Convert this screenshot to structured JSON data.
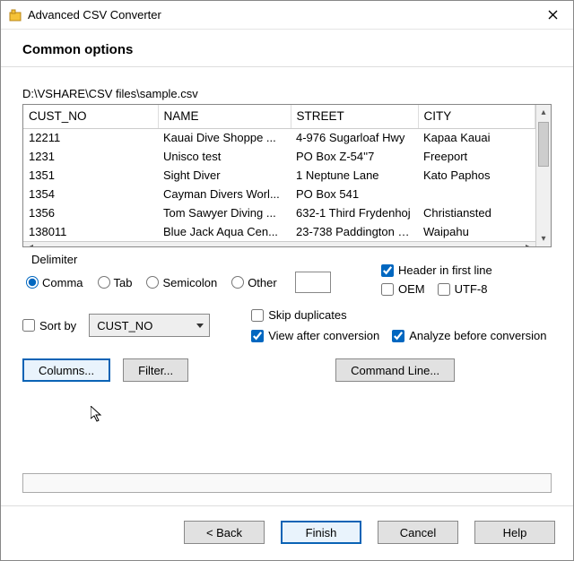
{
  "window": {
    "title": "Advanced CSV Converter"
  },
  "heading": "Common options",
  "filepath": "D:\\VSHARE\\CSV files\\sample.csv",
  "table": {
    "columns": [
      "CUST_NO",
      "NAME",
      "STREET",
      "CITY"
    ],
    "rows": [
      [
        "12211",
        " Kauai Dive Shoppe ...",
        "4-976 Sugarloaf Hwy",
        "Kapaa Kauai"
      ],
      [
        "1231",
        "Unisco  test",
        "PO Box Z-54''7",
        "Freeport"
      ],
      [
        "1351",
        "Sight Diver",
        "1 Neptune Lane",
        "Kato Paphos"
      ],
      [
        "1354",
        "Cayman Divers Worl...",
        "PO Box 541",
        ""
      ],
      [
        "1356",
        "Tom Sawyer Diving ...",
        "632-1 Third Frydenhoj",
        "Christiansted"
      ],
      [
        "138011",
        "Blue Jack Aqua Cen...",
        "23-738 Paddington L...",
        "Waipahu"
      ]
    ]
  },
  "delimiter": {
    "label": "Delimiter",
    "options": {
      "comma": "Comma",
      "tab": "Tab",
      "semicolon": "Semicolon",
      "other": "Other"
    },
    "selected": "comma",
    "other_value": ""
  },
  "checks": {
    "header_first_line": {
      "label": "Header in first line",
      "checked": true
    },
    "oem": {
      "label": "OEM",
      "checked": false
    },
    "utf8": {
      "label": "UTF-8",
      "checked": false
    },
    "sort_by": {
      "label": "Sort by",
      "checked": false
    },
    "skip_dup": {
      "label": "Skip duplicates",
      "checked": false
    },
    "view_after": {
      "label": "View after conversion",
      "checked": true
    },
    "analyze": {
      "label": "Analyze before conversion",
      "checked": true
    }
  },
  "sort_field": "CUST_NO",
  "buttons": {
    "columns": "Columns...",
    "filter": "Filter...",
    "command_line": "Command Line...",
    "back": "< Back",
    "finish": "Finish",
    "cancel": "Cancel",
    "help": "Help"
  }
}
